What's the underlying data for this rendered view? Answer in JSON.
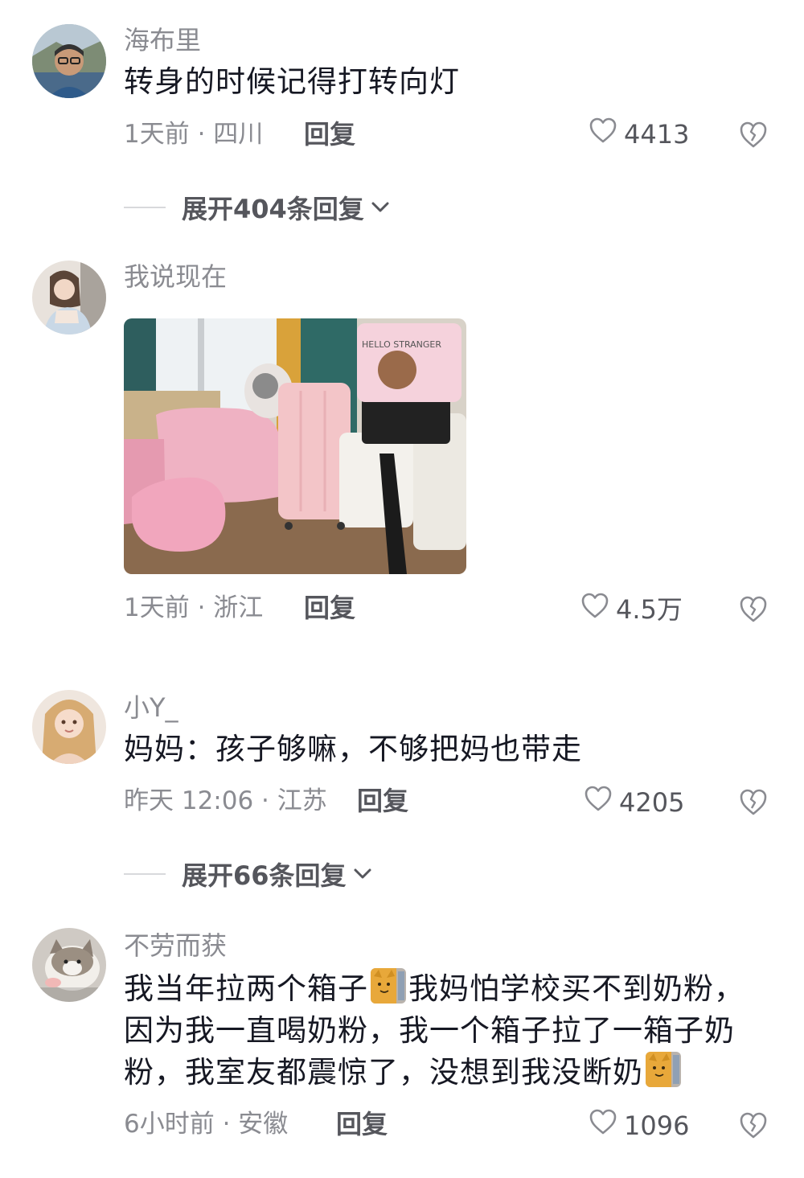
{
  "comments": [
    {
      "username": "海布里",
      "text": "转身的时候记得打转向灯",
      "time_location": "1天前 · 四川",
      "reply_label": "回复",
      "likes": "4413",
      "expand_label": "展开404条回复"
    },
    {
      "username": "我说现在",
      "text": "",
      "has_image": true,
      "time_location": "1天前 · 浙江",
      "reply_label": "回复",
      "likes": "4.5万"
    },
    {
      "username": "小Y_",
      "text": "妈妈：孩子够嘛，不够把妈也带走",
      "time_location": "昨天 12:06 · 江苏",
      "reply_label": "回复",
      "likes": "4205",
      "expand_label": "展开66条回复"
    },
    {
      "username": "不劳而获",
      "text_parts": [
        "我当年拉两个箱子",
        "我妈怕学校买不到奶粉，因为我一直喝奶粉，我一个箱子拉了一箱子奶粉，我室友都震惊了，没想到我没断奶"
      ],
      "time_location": "6小时前 · 安徽",
      "reply_label": "回复",
      "likes": "1096"
    }
  ],
  "photo_sticker_text": "HELLO STRANGER",
  "icons": {
    "like": "heart-outline-icon",
    "dislike": "broken-heart-icon",
    "expand": "chevron-down-icon",
    "emoji": "cat-emoji-icon"
  },
  "colors": {
    "primary_text": "#161823",
    "secondary_text": "#8a8b91",
    "action_text": "#55565c"
  }
}
